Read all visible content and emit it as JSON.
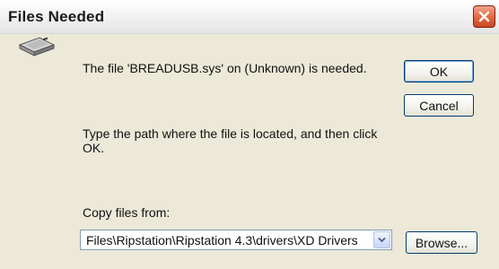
{
  "window": {
    "title": "Files Needed"
  },
  "message": {
    "file_needed": "The file 'BREADUSB.sys' on (Unknown) is needed.",
    "instruction": "Type the path where the file is located, and then click OK."
  },
  "copy_from": {
    "label": "Copy files from:",
    "value": "Files\\Ripstation\\Ripstation 4.3\\drivers\\XD Drivers"
  },
  "buttons": {
    "ok": "OK",
    "cancel": "Cancel",
    "browse": "Browse..."
  },
  "icons": {
    "title_close": "close-icon",
    "drive": "disk-drive-icon",
    "dropdown": "chevron-down-icon"
  },
  "colors": {
    "dialog_background": "#ece9d8",
    "close_button": "#e4714e",
    "default_button_border": "#003c74"
  }
}
